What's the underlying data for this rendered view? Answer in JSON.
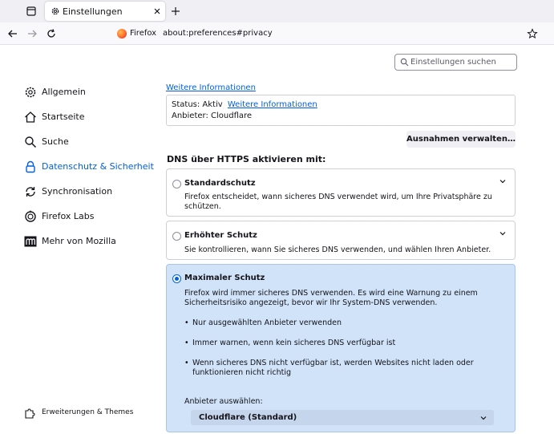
{
  "tabbar": {
    "tab_title": "Einstellungen"
  },
  "navbar": {
    "identity_label": "Firefox",
    "url": "about:preferences#privacy"
  },
  "search": {
    "placeholder": "Einstellungen suchen"
  },
  "sidebar": {
    "items": [
      {
        "label": "Allgemein",
        "icon": "gear-icon"
      },
      {
        "label": "Startseite",
        "icon": "home-icon"
      },
      {
        "label": "Suche",
        "icon": "search-icon"
      },
      {
        "label": "Datenschutz & Sicherheit",
        "icon": "lock-icon",
        "active": true
      },
      {
        "label": "Synchronisation",
        "icon": "sync-icon"
      },
      {
        "label": "Firefox Labs",
        "icon": "labs-icon"
      },
      {
        "label": "Mehr von Mozilla",
        "icon": "mozilla-icon"
      }
    ],
    "extensions_label": "Erweiterungen & Themes"
  },
  "main": {
    "top_link": "Weitere Informationen",
    "status": {
      "status_prefix": "Status: Aktiv",
      "status_link": "Weitere Informationen",
      "provider_line": "Anbieter: Cloudflare"
    },
    "exceptions_button": "Ausnahmen verwalten…",
    "dns_heading": "DNS über HTTPS aktivieren mit:",
    "options": [
      {
        "title": "Standardschutz",
        "desc": "Firefox entscheidet, wann sicheres DNS verwendet wird, um Ihre Privatsphäre zu schützen.",
        "selected": false
      },
      {
        "title": "Erhöhter Schutz",
        "desc": "Sie kontrollieren, wann Sie sicheres DNS verwenden, und wählen Ihren Anbieter.",
        "selected": false
      },
      {
        "title": "Maximaler Schutz",
        "desc": "Firefox wird immer sicheres DNS verwenden. Es wird eine Warnung zu einem Sicherheitsrisiko angezeigt, bevor wir Ihr System-DNS verwenden.",
        "selected": true,
        "bullets": [
          "Nur ausgewählten Anbieter verwenden",
          "Immer warnen, wenn kein sicheres DNS verfügbar ist",
          "Wenn sicheres DNS nicht verfügbar ist, werden Websites nicht laden oder funktionieren nicht richtig"
        ],
        "provider_label": "Anbieter auswählen:",
        "provider_value": "Cloudflare (Standard)"
      }
    ]
  },
  "colors": {
    "accent": "#0061e0",
    "selected_card_bg": "#d0e3f9"
  }
}
